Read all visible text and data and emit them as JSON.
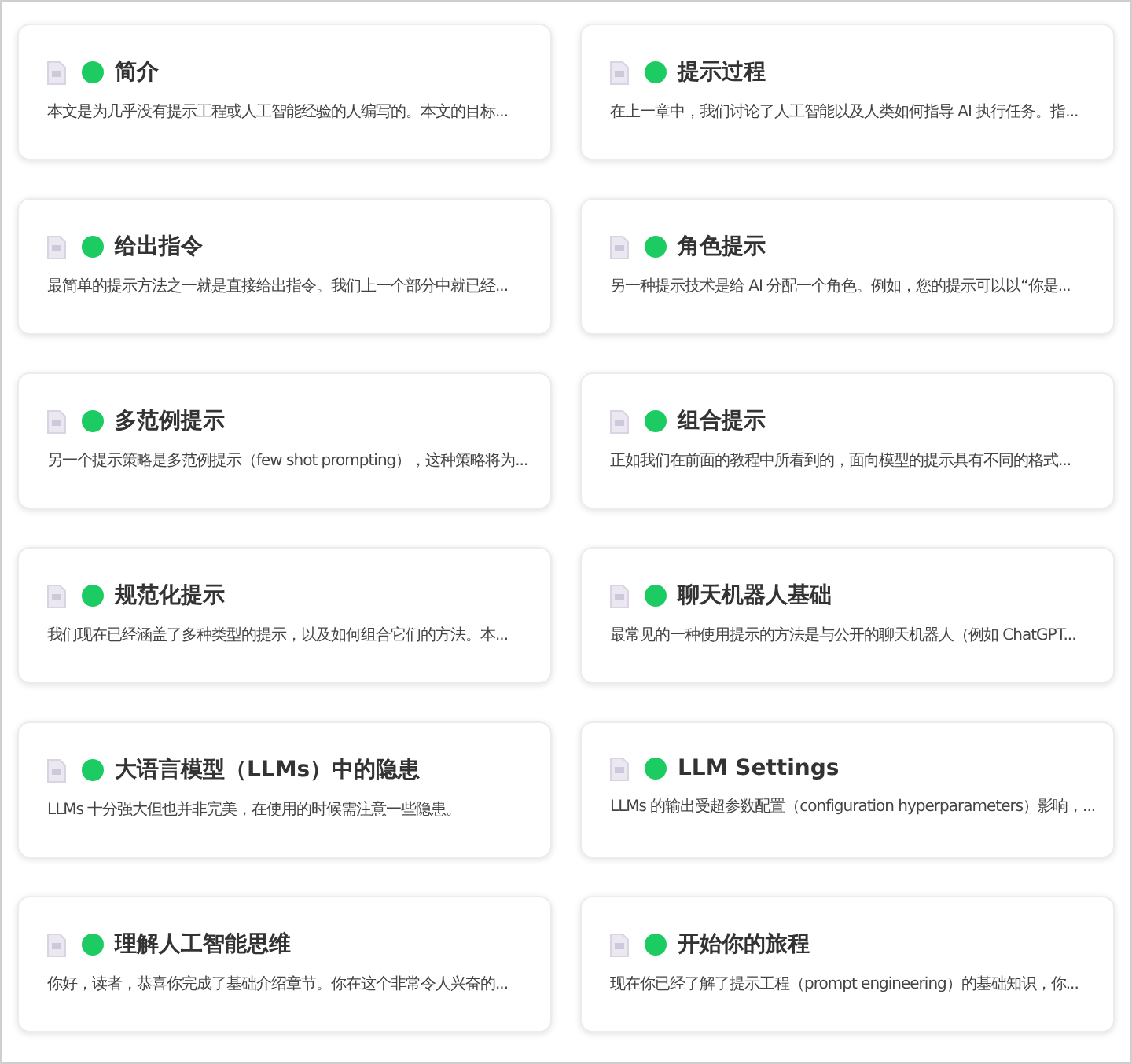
{
  "lessons": [
    {
      "title": "简介",
      "summary": "本文是为几乎没有提示工程或人工智能经验的人编写的。本文的目标..."
    },
    {
      "title": "提示过程",
      "summary": "在上一章中，我们讨论了人工智能以及人类如何指导 AI 执行任务。指..."
    },
    {
      "title": "给出指令",
      "summary": "最简单的提示方法之一就是直接给出指令。我们上一个部分中就已经..."
    },
    {
      "title": "角色提示",
      "summary": "另一种提示技术是给 AI 分配一个角色。例如，您的提示可以以“你是..."
    },
    {
      "title": "多范例提示",
      "summary": "另一个提示策略是多范例提示（few shot prompting），这种策略将为..."
    },
    {
      "title": "组合提示",
      "summary": "正如我们在前面的教程中所看到的，面向模型的提示具有不同的格式..."
    },
    {
      "title": "规范化提示",
      "summary": "我们现在已经涵盖了多种类型的提示，以及如何组合它们的方法。本..."
    },
    {
      "title": "聊天机器人基础",
      "summary": "最常见的一种使用提示的方法是与公开的聊天机器人（例如 ChatGPT..."
    },
    {
      "title": "大语言模型（LLMs）中的隐患",
      "summary": "LLMs 十分强大但也并非完美，在使用的时候需注意一些隐患。"
    },
    {
      "title": "LLM Settings",
      "summary": "LLMs 的输出受超参数配置（configuration hyperparameters）影响，..."
    },
    {
      "title": "理解人工智能思维",
      "summary": "你好，读者，恭喜你完成了基础介绍章节。你在这个非常令人兴奋的..."
    },
    {
      "title": "开始你的旅程",
      "summary": "现在你已经了解了提示工程（prompt engineering）的基础知识，你..."
    }
  ]
}
